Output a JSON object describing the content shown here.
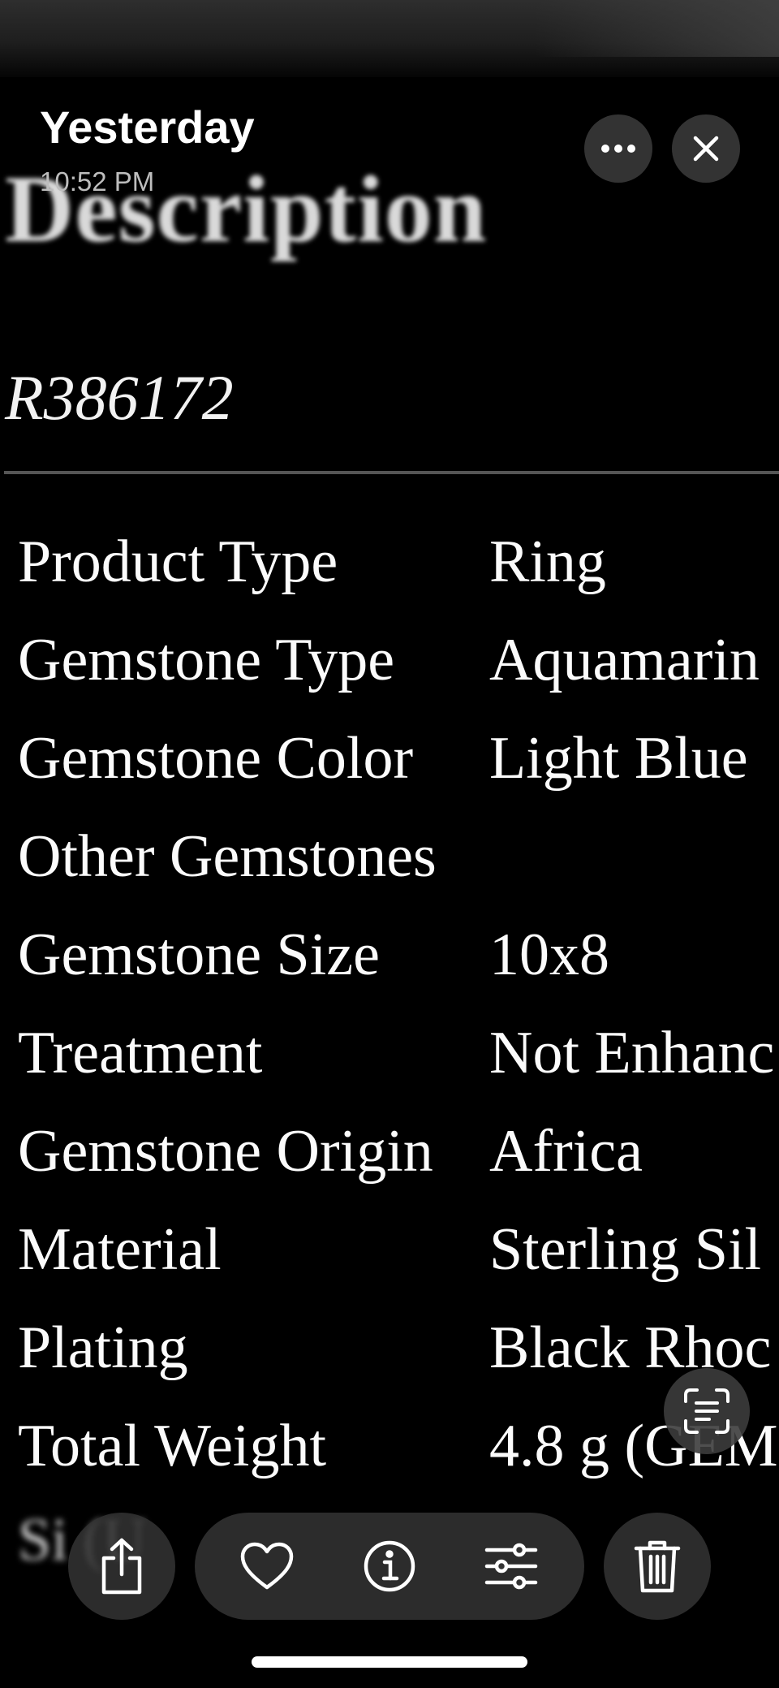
{
  "header": {
    "title": "Yesterday",
    "time": "10:52 PM",
    "more_icon": "ellipsis-icon",
    "close_icon": "close-icon"
  },
  "photo": {
    "heading": "Description",
    "sku": "R386172",
    "specs": [
      {
        "label": "Product Type",
        "value": "Ring"
      },
      {
        "label": "Gemstone Type",
        "value": "Aquamarin"
      },
      {
        "label": "Gemstone Color",
        "value": "Light Blue"
      },
      {
        "label": "Other Gemstones",
        "value": ""
      },
      {
        "label": "Gemstone Size",
        "value": "10x8"
      },
      {
        "label": "Treatment",
        "value": "Not Enhanc"
      },
      {
        "label": "Gemstone Origin",
        "value": "Africa"
      },
      {
        "label": "Material",
        "value": "Sterling Sil"
      },
      {
        "label": "Plating",
        "value": "Black Rhoc"
      },
      {
        "label": "Total Weight",
        "value": "4.8 g (GEM"
      }
    ],
    "partial_row_text": "Si (U"
  },
  "toolbar": {
    "share_icon": "share-icon",
    "favorite_icon": "heart-icon",
    "info_icon": "info-icon",
    "adjust_icon": "sliders-icon",
    "delete_icon": "trash-icon",
    "live_text_icon": "live-text-icon"
  }
}
